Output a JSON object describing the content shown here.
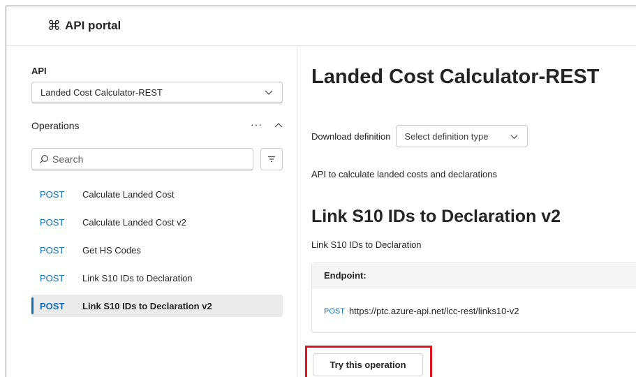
{
  "header": {
    "logo_icon": "command-icon",
    "title": "API portal"
  },
  "sidebar": {
    "api_label": "API",
    "api_selected": "Landed Cost Calculator-REST",
    "operations_label": "Operations",
    "more_label": "···",
    "search_placeholder": "Search",
    "operations": [
      {
        "method": "POST",
        "name": "Calculate Landed Cost",
        "active": false
      },
      {
        "method": "POST",
        "name": "Calculate Landed Cost v2",
        "active": false
      },
      {
        "method": "POST",
        "name": "Get HS Codes",
        "active": false
      },
      {
        "method": "POST",
        "name": "Link S10 IDs to Declaration",
        "active": false
      },
      {
        "method": "POST",
        "name": "Link S10 IDs to Declaration v2",
        "active": true
      }
    ]
  },
  "main": {
    "title": "Landed Cost Calculator-REST",
    "download_label": "Download definition",
    "download_placeholder": "Select definition type",
    "api_description": "API to calculate landed costs and declarations",
    "operation_title": "Link S10 IDs to Declaration v2",
    "operation_description": "Link S10 IDs to Declaration",
    "endpoint_label": "Endpoint:",
    "endpoint_method": "POST",
    "endpoint_url": "https://ptc.azure-api.net/lcc-rest/links10-v2",
    "try_button": "Try this operation"
  },
  "colors": {
    "accent": "#0f6cbd",
    "highlight": "#e0141e",
    "active_bg": "#ebebeb"
  }
}
